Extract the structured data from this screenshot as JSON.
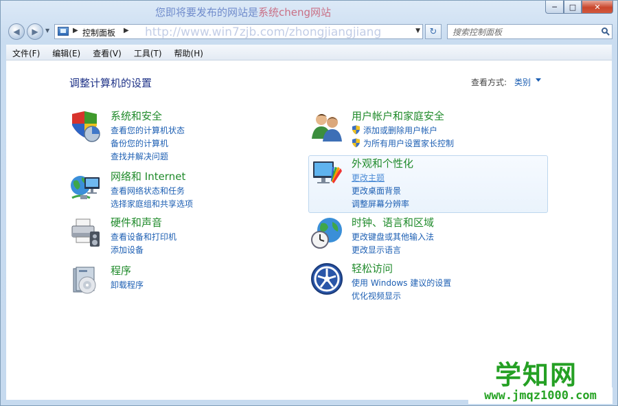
{
  "window": {
    "watermark_top_prefix": "您即将要发布的网站是",
    "watermark_top_brand": "系统cheng网站",
    "watermark_url": "http://www.win7zjb.com/zhongjiangjiang",
    "minimize": "─",
    "maximize": "□",
    "close": "✕"
  },
  "address": {
    "crumb": "控制面板",
    "sep": "▶",
    "dropdown": "▼",
    "refresh": "↻",
    "search_placeholder": "搜索控制面板"
  },
  "nav": {
    "back": "◀",
    "forward": "▶",
    "dropdown": "▼"
  },
  "menu": [
    "文件(F)",
    "编辑(E)",
    "查看(V)",
    "工具(T)",
    "帮助(H)"
  ],
  "content": {
    "title": "调整计算机的设置",
    "view_by_label": "查看方式:",
    "view_by_value": "类别"
  },
  "categories": {
    "system": {
      "title": "系统和安全",
      "links": [
        "查看您的计算机状态",
        "备份您的计算机",
        "查找并解决问题"
      ]
    },
    "network": {
      "title": "网络和 Internet",
      "links": [
        "查看网络状态和任务",
        "选择家庭组和共享选项"
      ]
    },
    "hardware": {
      "title": "硬件和声音",
      "links": [
        "查看设备和打印机",
        "添加设备"
      ]
    },
    "programs": {
      "title": "程序",
      "links": [
        "卸载程序"
      ]
    },
    "users": {
      "title": "用户帐户和家庭安全",
      "links": [
        "添加或删除用户帐户",
        "为所有用户设置家长控制"
      ]
    },
    "appearance": {
      "title": "外观和个性化",
      "links": [
        "更改主题",
        "更改桌面背景",
        "调整屏幕分辨率"
      ]
    },
    "clock": {
      "title": "时钟、语言和区域",
      "links": [
        "更改键盘或其他输入法",
        "更改显示语言"
      ]
    },
    "ease": {
      "title": "轻松访问",
      "links": [
        "使用 Windows 建议的设置",
        "优化视频显示"
      ]
    }
  },
  "site_watermark": {
    "logo": "学知网",
    "url": "www.jmqz1000.com"
  },
  "colors": {
    "title_green": "#1f8a2a",
    "link_blue": "#1d5fb3",
    "heading_navy": "#1e3287"
  }
}
